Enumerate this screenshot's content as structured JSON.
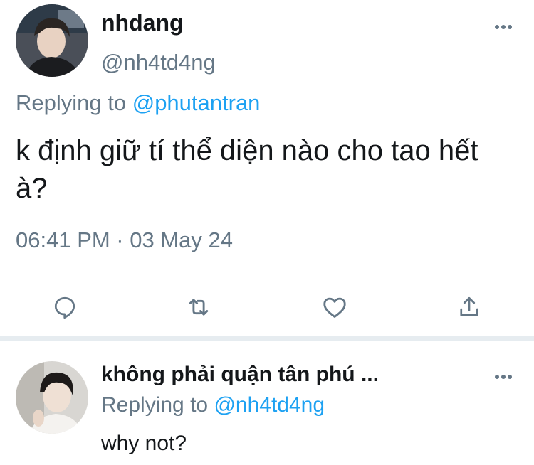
{
  "main_tweet": {
    "display_name": "nhdang",
    "handle": "@nh4td4ng",
    "replying_prefix": "Replying to",
    "replying_to": "@phutantran",
    "text": "k định giữ tí thể diện nào cho tao hết à?",
    "timestamp": "06:41 PM · 03 May 24"
  },
  "actions": [
    {
      "icon": "reply-icon"
    },
    {
      "icon": "retweet-icon"
    },
    {
      "icon": "like-icon"
    },
    {
      "icon": "share-icon"
    }
  ],
  "reply_tweet": {
    "display_name": "không phải quận tân phú ...",
    "replying_prefix": "Replying to",
    "replying_to": "@nh4td4ng",
    "text": "why not?"
  },
  "colors": {
    "accent": "#1da1f2",
    "secondary_text": "#657786",
    "primary_text": "#14171a",
    "divider": "#e1e8ed"
  }
}
